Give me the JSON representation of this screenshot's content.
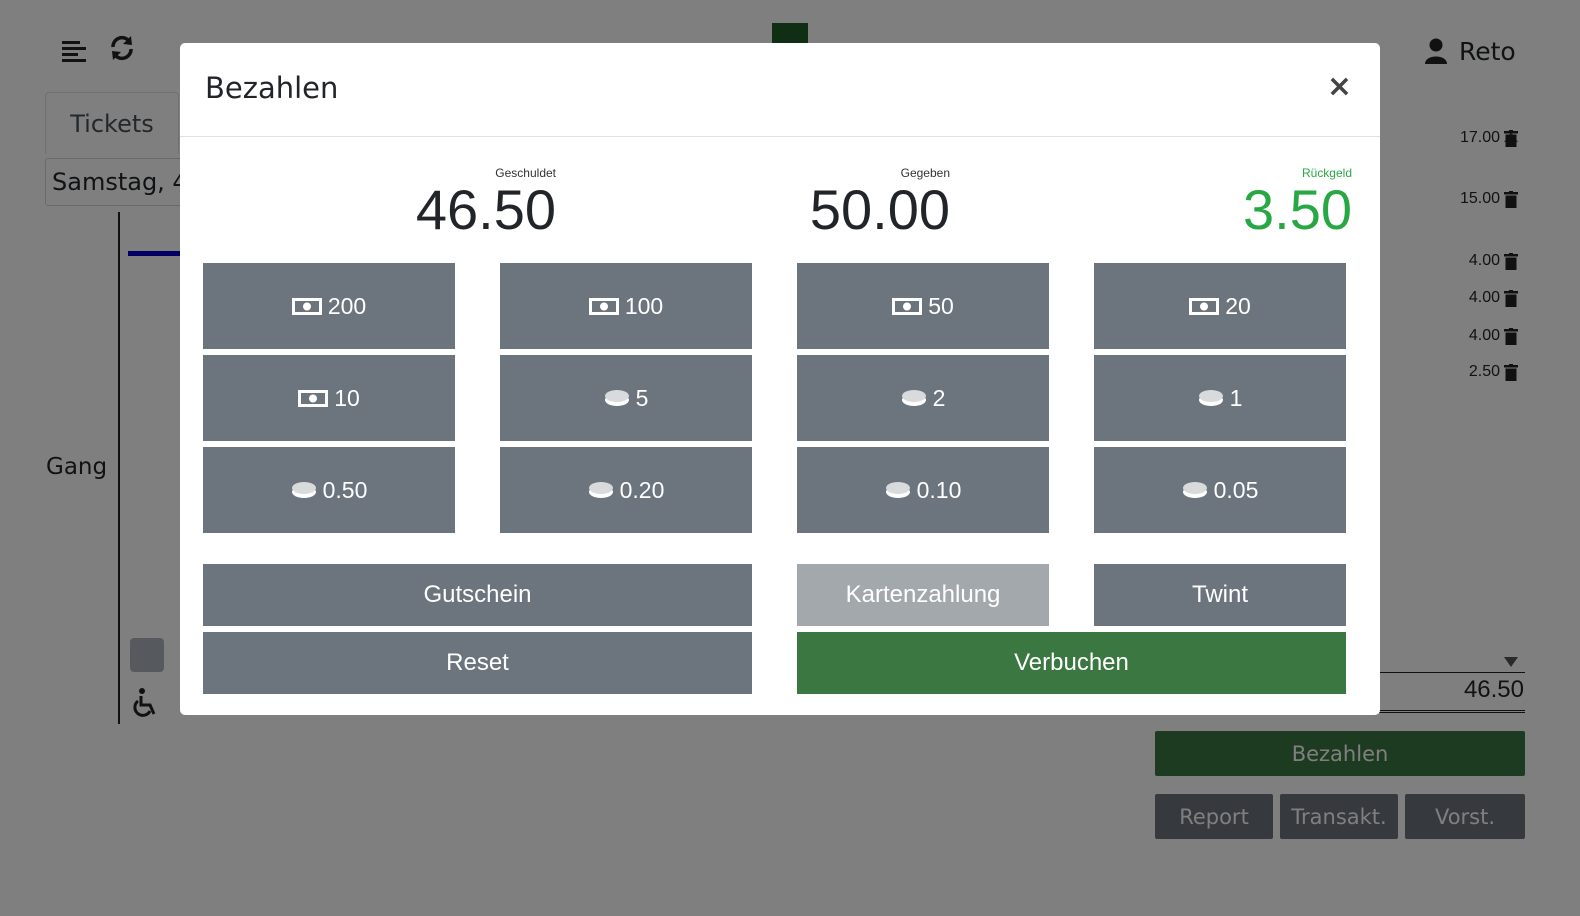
{
  "header": {
    "user_name": "Reto"
  },
  "tabs": {
    "tickets_label": "Tickets"
  },
  "date_select": {
    "value": "Samstag, 4"
  },
  "hall": {
    "aisle_label": "Gang"
  },
  "cart": {
    "items": [
      {
        "price": "17.00"
      },
      {
        "price": "15.00"
      },
      {
        "price": "4.00"
      },
      {
        "price": "4.00"
      },
      {
        "price": "4.00"
      },
      {
        "price": "2.50"
      }
    ],
    "total": "46.50",
    "pay_label": "Bezahlen",
    "report_label": "Report",
    "transactions_label": "Transakt.",
    "performances_label": "Vorst."
  },
  "modal": {
    "title": "Bezahlen",
    "close_symbol": "×",
    "owed_label": "Geschuldet",
    "owed_value": "46.50",
    "given_label": "Gegeben",
    "given_value": "50.00",
    "change_label": "Rückgeld",
    "change_value": "3.50",
    "change_color": "#28a745",
    "denominations": [
      {
        "label": "200",
        "icon": "banknote-icon"
      },
      {
        "label": "100",
        "icon": "banknote-icon"
      },
      {
        "label": "50",
        "icon": "banknote-icon"
      },
      {
        "label": "20",
        "icon": "banknote-icon"
      },
      {
        "label": "10",
        "icon": "banknote-icon"
      },
      {
        "label": "5",
        "icon": "coin-icon"
      },
      {
        "label": "2",
        "icon": "coin-icon"
      },
      {
        "label": "1",
        "icon": "coin-icon"
      },
      {
        "label": "0.50",
        "icon": "coin-icon"
      },
      {
        "label": "0.20",
        "icon": "coin-icon"
      },
      {
        "label": "0.10",
        "icon": "coin-icon"
      },
      {
        "label": "0.05",
        "icon": "coin-icon"
      }
    ],
    "voucher_label": "Gutschein",
    "card_label": "Kartenzahlung",
    "twint_label": "Twint",
    "reset_label": "Reset",
    "book_label": "Verbuchen"
  }
}
